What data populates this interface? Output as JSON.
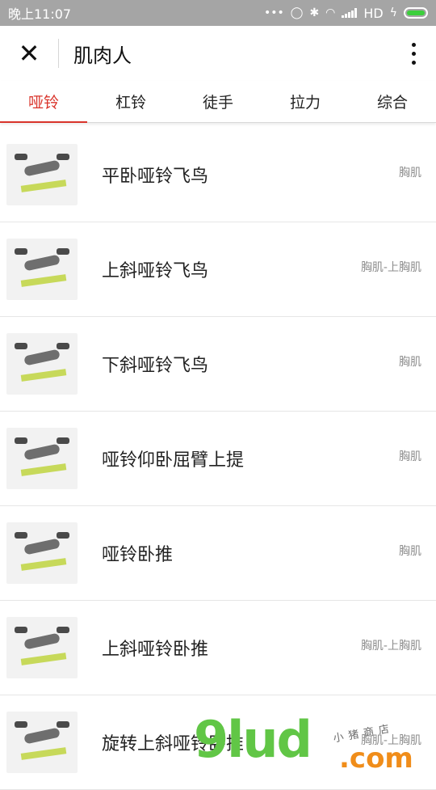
{
  "status_bar": {
    "time": "晚上11:07",
    "network": "HD",
    "icons": [
      "more-dots-icon",
      "alarm-icon",
      "bluetooth-icon",
      "wifi-icon",
      "signal-icon",
      "charging-icon",
      "battery-icon"
    ],
    "battery_color": "#3ccf3c"
  },
  "app_bar": {
    "close_icon": "close-icon",
    "title": "肌肉人",
    "more_icon": "more-vertical-icon"
  },
  "tabs": [
    {
      "label": "哑铃",
      "active": true
    },
    {
      "label": "杠铃",
      "active": false
    },
    {
      "label": "徒手",
      "active": false
    },
    {
      "label": "拉力",
      "active": false
    },
    {
      "label": "综合",
      "active": false
    }
  ],
  "accent_color": "#d9342b",
  "exercises": [
    {
      "name": "平卧哑铃飞鸟",
      "muscle": "胸肌"
    },
    {
      "name": "上斜哑铃飞鸟",
      "muscle": "胸肌-上胸肌"
    },
    {
      "name": "下斜哑铃飞鸟",
      "muscle": "胸肌"
    },
    {
      "name": "哑铃仰卧屈臂上提",
      "muscle": "胸肌"
    },
    {
      "name": "哑铃卧推",
      "muscle": "胸肌"
    },
    {
      "name": "上斜哑铃卧推",
      "muscle": "胸肌-上胸肌"
    },
    {
      "name": "旋转上斜哑铃卧推",
      "muscle": "胸肌-上胸肌"
    }
  ],
  "watermark": {
    "main": "9lud",
    "suffix": ".com",
    "sub": "小猪商店"
  }
}
